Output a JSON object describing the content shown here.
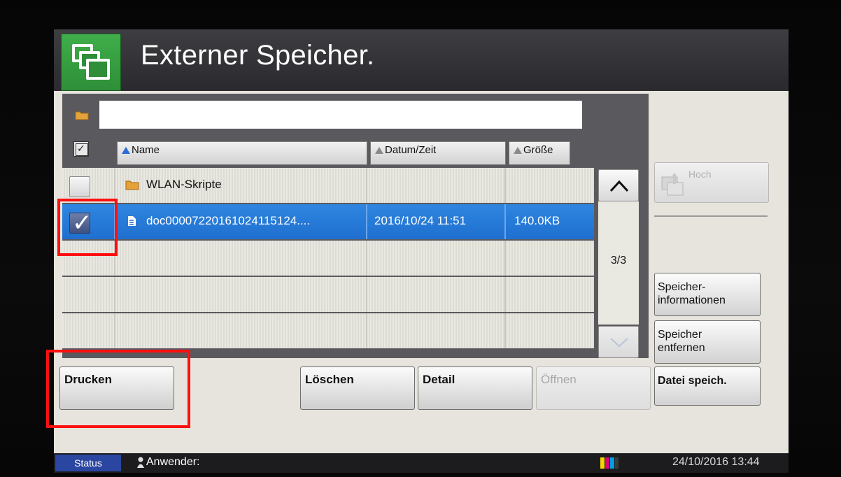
{
  "window": {
    "title": "Externer Speicher."
  },
  "path": {
    "value": ""
  },
  "columns": {
    "name": "Name",
    "datetime": "Datum/Zeit",
    "size": "Größe"
  },
  "rows": [
    {
      "name": "WLAN-Skripte",
      "type": "folder",
      "datetime": "",
      "size": "",
      "checked": false,
      "selected": false
    },
    {
      "name": "doc00007220161024115124....",
      "type": "file",
      "datetime": "2016/10/24 11:51",
      "size": "140.0KB",
      "checked": true,
      "selected": true
    }
  ],
  "pagination": {
    "indicator": "3/3"
  },
  "side_buttons": {
    "hoch": "Hoch",
    "storage_info": "Speicher-\ninformationen",
    "remove_storage": "Speicher\nentfernen",
    "save_file": "Datei speich."
  },
  "bottom_buttons": {
    "print": "Drucken",
    "delete": "Löschen",
    "detail": "Detail",
    "open": "Öffnen"
  },
  "statusbar": {
    "status_label": "Status",
    "user_label": "Anwender:",
    "datetime": "24/10/2016 13:44"
  },
  "colors": {
    "accent_green": "#3fae4a",
    "selection_blue": "#1f6fcf",
    "highlight_red": "#ff1010",
    "status_blue": "#2a46a0"
  },
  "icons": [
    "folder-stack-icon",
    "folder-icon",
    "file-icon",
    "chevron-up-icon",
    "chevron-down-icon",
    "user-icon",
    "toner-icon"
  ]
}
